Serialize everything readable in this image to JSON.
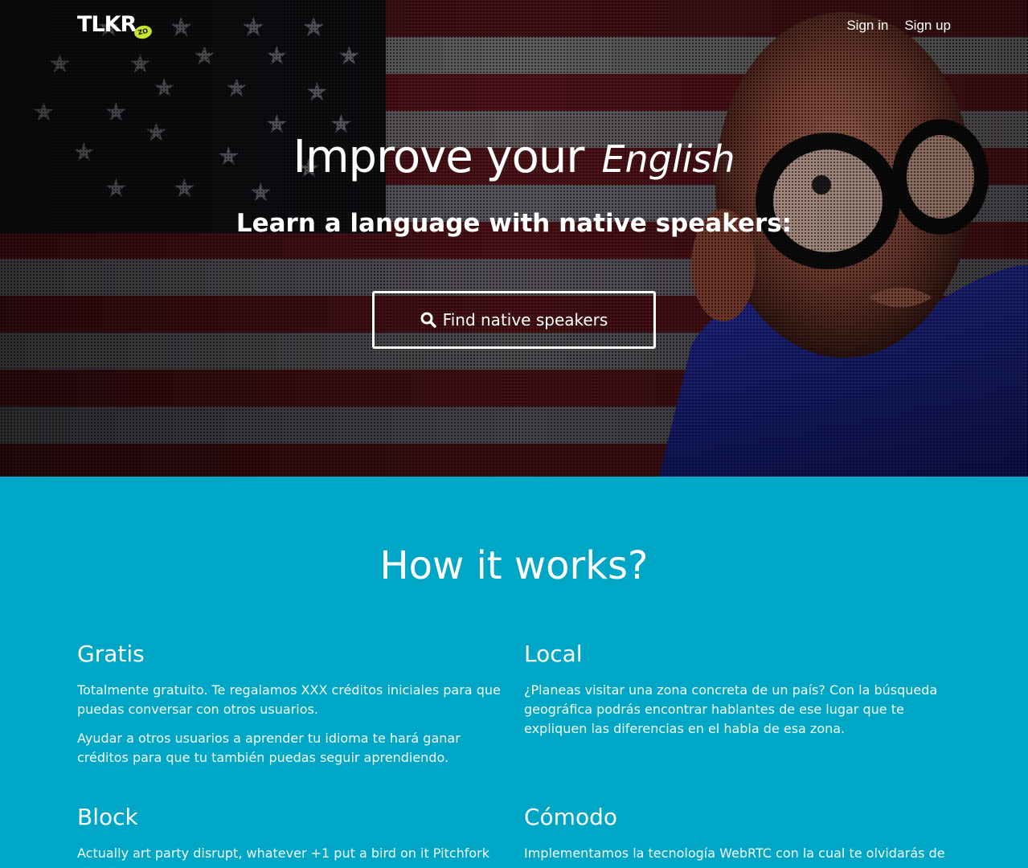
{
  "brand": {
    "logo": "TLKR",
    "badge": "ZO"
  },
  "nav": {
    "sign_in": "Sign in",
    "sign_up": "Sign up"
  },
  "hero": {
    "title": "Improve your",
    "language": "English",
    "subtitle": "Learn a language with native speakers:",
    "cta_label": "Find native speakers",
    "cta_icon": "search-icon"
  },
  "how": {
    "title": "How it works?",
    "features": [
      {
        "title": "Gratis",
        "paragraphs": [
          "Totalmente gratuito. Te regalamos XXX créditos iniciales para que puedas conversar con otros usuarios.",
          "Ayudar a otros usuarios a aprender tu idioma te hará ganar créditos para que tu también puedas seguir aprendiendo."
        ]
      },
      {
        "title": "Local",
        "paragraphs": [
          "¿Planeas visitar una zona concreta de un país? Con la búsqueda geográfica podrás encontrar hablantes de ese lugar que te expliquen las diferencias en el habla de esa zona."
        ]
      },
      {
        "title": "Block",
        "paragraphs": [
          "Actually art party disrupt, whatever +1 put a bird on it Pitchfork street"
        ]
      },
      {
        "title": "Cómodo",
        "paragraphs": [
          "Implementamos la tecnología WebRTC con la cual te olvidarás de usar"
        ]
      }
    ]
  },
  "colors": {
    "accent": "#00a6c6",
    "logo_badge": "#c6e52c"
  }
}
